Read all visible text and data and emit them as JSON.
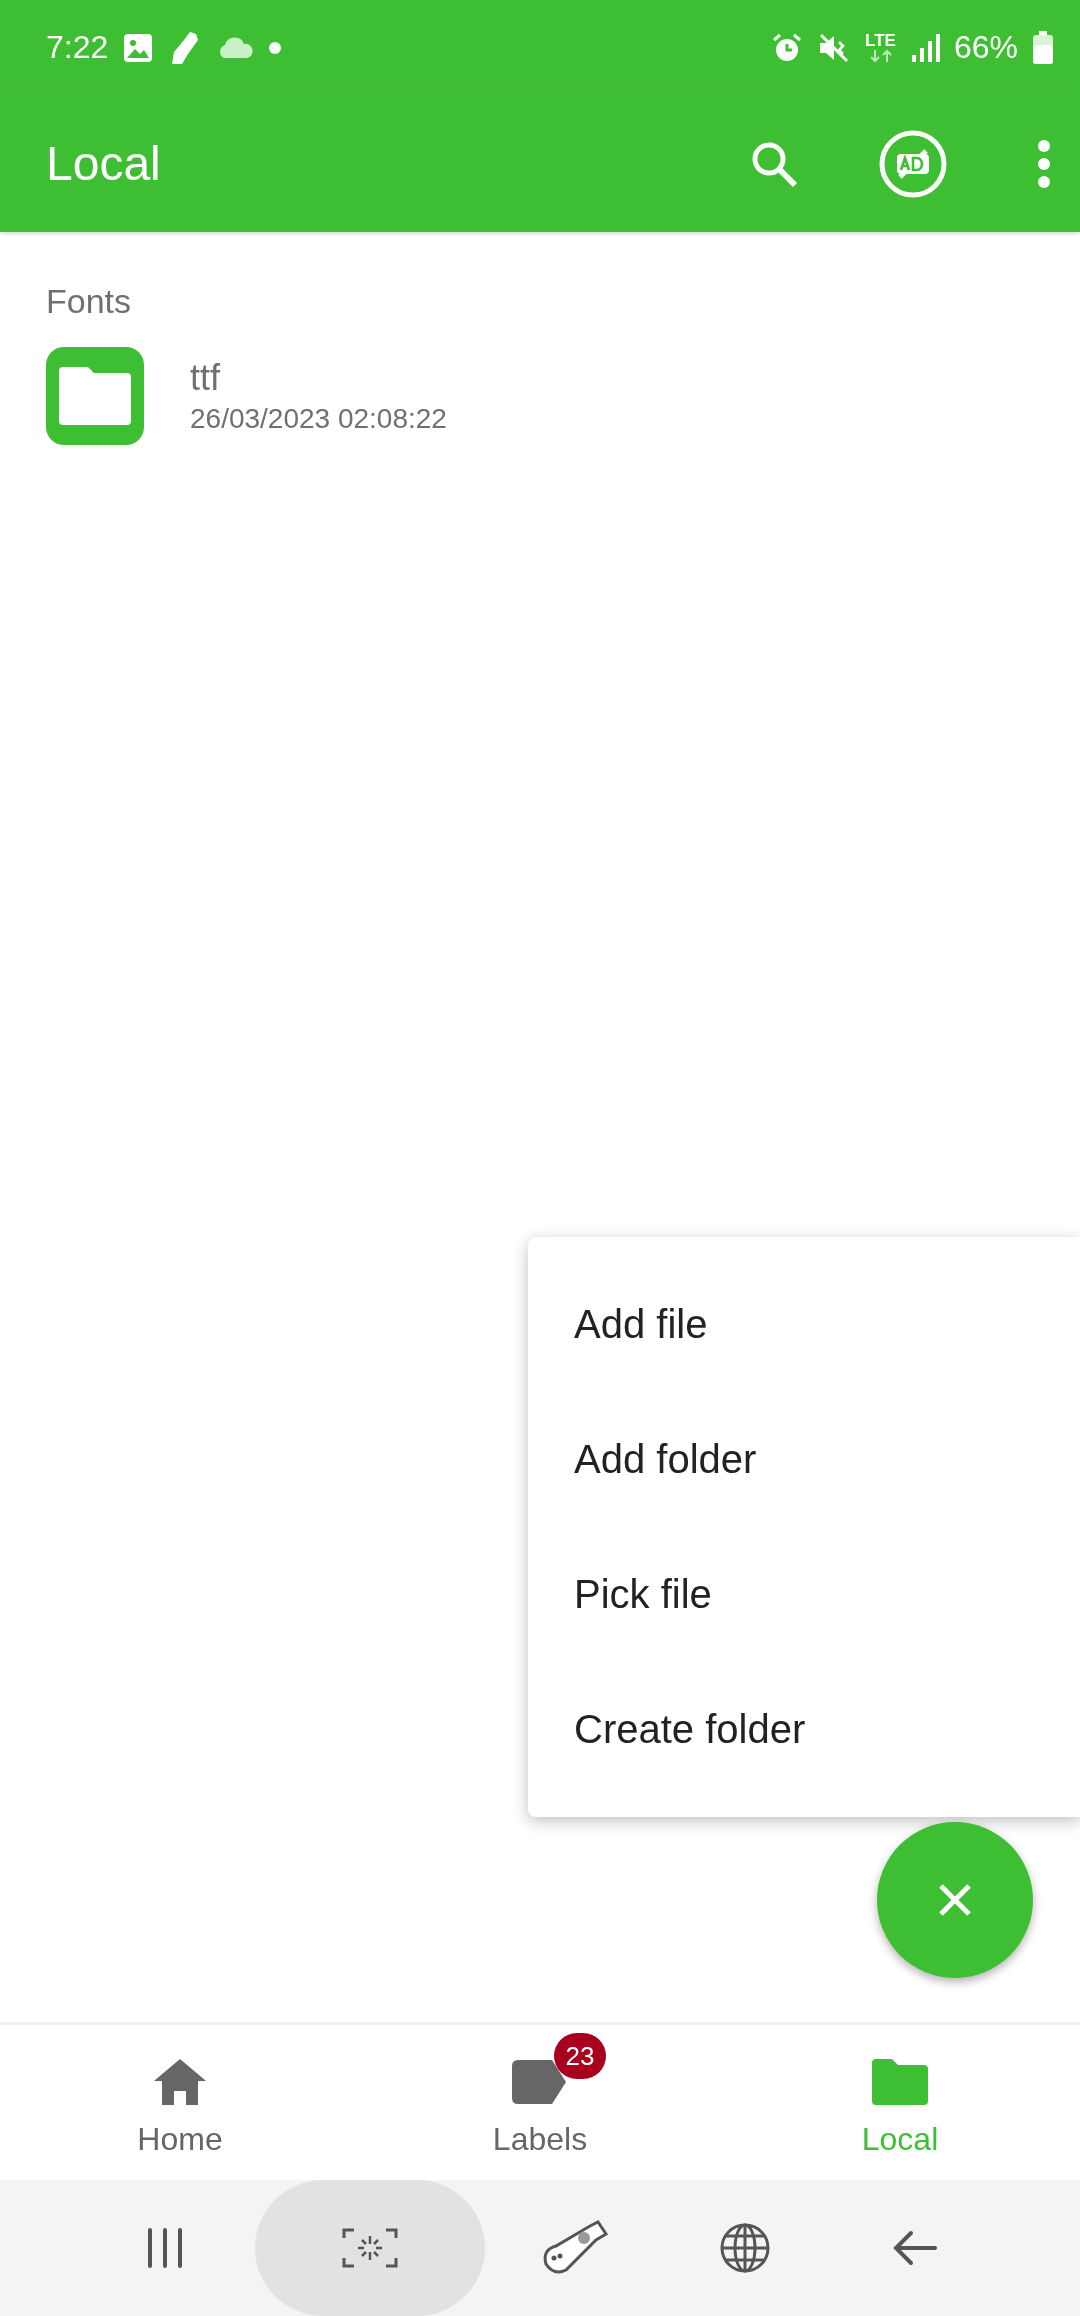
{
  "status_bar": {
    "time": "7:22",
    "network": "LTE",
    "battery": "66%"
  },
  "app_bar": {
    "title": "Local"
  },
  "section": {
    "title": "Fonts"
  },
  "files": [
    {
      "name": "ttf",
      "date": "26/03/2023 02:08:22"
    }
  ],
  "menu": {
    "items": [
      "Add file",
      "Add folder",
      "Pick file",
      "Create folder"
    ]
  },
  "bottom_nav": [
    {
      "label": "Home",
      "kind": "home",
      "selected": false
    },
    {
      "label": "Labels",
      "kind": "labels",
      "selected": false,
      "badge": "23"
    },
    {
      "label": "Local",
      "kind": "folder",
      "selected": true
    }
  ]
}
